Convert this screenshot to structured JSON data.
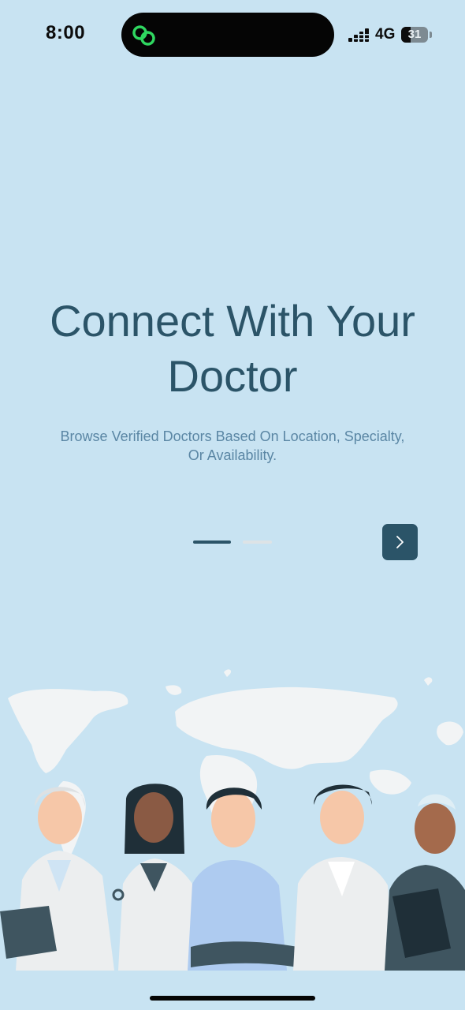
{
  "status_bar": {
    "time": "8:00",
    "network": "4G",
    "battery": "31",
    "icons": [
      "link-icon",
      "signal-icon",
      "battery-icon"
    ]
  },
  "onboarding": {
    "title_line1": "Connect With Your",
    "title_line2": "Doctor",
    "subtitle": "Browse Verified Doctors Based On Location, Specialty, Or Availability.",
    "current_page": 1,
    "page_count": 2,
    "next_icon": "chevron-right-icon"
  },
  "illustration": {
    "icon": "doctors-world-map-illustration"
  },
  "colors": {
    "background": "#c8e3f2",
    "primary": "#2b5468",
    "subtitle": "#5a86a4",
    "map": "#f2f4f5",
    "inactive_dot": "#dde3e6"
  }
}
